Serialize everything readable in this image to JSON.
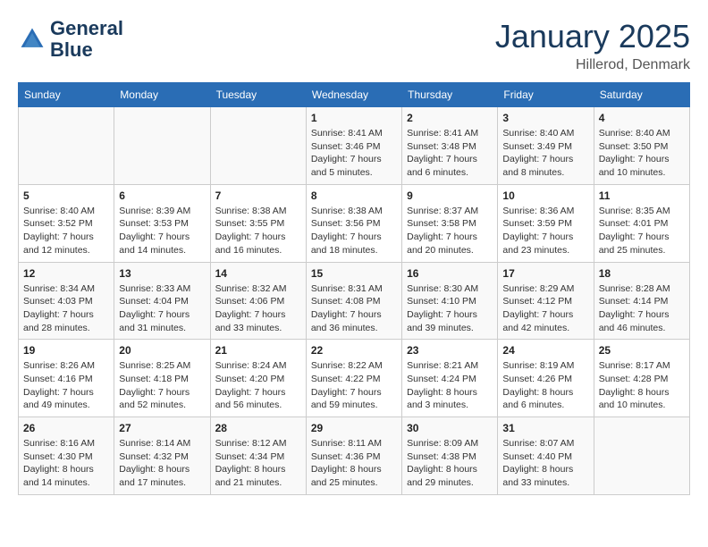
{
  "header": {
    "logo_line1": "General",
    "logo_line2": "Blue",
    "month": "January 2025",
    "location": "Hillerod, Denmark"
  },
  "weekdays": [
    "Sunday",
    "Monday",
    "Tuesday",
    "Wednesday",
    "Thursday",
    "Friday",
    "Saturday"
  ],
  "weeks": [
    [
      {
        "day": "",
        "info": ""
      },
      {
        "day": "",
        "info": ""
      },
      {
        "day": "",
        "info": ""
      },
      {
        "day": "1",
        "info": "Sunrise: 8:41 AM\nSunset: 3:46 PM\nDaylight: 7 hours\nand 5 minutes."
      },
      {
        "day": "2",
        "info": "Sunrise: 8:41 AM\nSunset: 3:48 PM\nDaylight: 7 hours\nand 6 minutes."
      },
      {
        "day": "3",
        "info": "Sunrise: 8:40 AM\nSunset: 3:49 PM\nDaylight: 7 hours\nand 8 minutes."
      },
      {
        "day": "4",
        "info": "Sunrise: 8:40 AM\nSunset: 3:50 PM\nDaylight: 7 hours\nand 10 minutes."
      }
    ],
    [
      {
        "day": "5",
        "info": "Sunrise: 8:40 AM\nSunset: 3:52 PM\nDaylight: 7 hours\nand 12 minutes."
      },
      {
        "day": "6",
        "info": "Sunrise: 8:39 AM\nSunset: 3:53 PM\nDaylight: 7 hours\nand 14 minutes."
      },
      {
        "day": "7",
        "info": "Sunrise: 8:38 AM\nSunset: 3:55 PM\nDaylight: 7 hours\nand 16 minutes."
      },
      {
        "day": "8",
        "info": "Sunrise: 8:38 AM\nSunset: 3:56 PM\nDaylight: 7 hours\nand 18 minutes."
      },
      {
        "day": "9",
        "info": "Sunrise: 8:37 AM\nSunset: 3:58 PM\nDaylight: 7 hours\nand 20 minutes."
      },
      {
        "day": "10",
        "info": "Sunrise: 8:36 AM\nSunset: 3:59 PM\nDaylight: 7 hours\nand 23 minutes."
      },
      {
        "day": "11",
        "info": "Sunrise: 8:35 AM\nSunset: 4:01 PM\nDaylight: 7 hours\nand 25 minutes."
      }
    ],
    [
      {
        "day": "12",
        "info": "Sunrise: 8:34 AM\nSunset: 4:03 PM\nDaylight: 7 hours\nand 28 minutes."
      },
      {
        "day": "13",
        "info": "Sunrise: 8:33 AM\nSunset: 4:04 PM\nDaylight: 7 hours\nand 31 minutes."
      },
      {
        "day": "14",
        "info": "Sunrise: 8:32 AM\nSunset: 4:06 PM\nDaylight: 7 hours\nand 33 minutes."
      },
      {
        "day": "15",
        "info": "Sunrise: 8:31 AM\nSunset: 4:08 PM\nDaylight: 7 hours\nand 36 minutes."
      },
      {
        "day": "16",
        "info": "Sunrise: 8:30 AM\nSunset: 4:10 PM\nDaylight: 7 hours\nand 39 minutes."
      },
      {
        "day": "17",
        "info": "Sunrise: 8:29 AM\nSunset: 4:12 PM\nDaylight: 7 hours\nand 42 minutes."
      },
      {
        "day": "18",
        "info": "Sunrise: 8:28 AM\nSunset: 4:14 PM\nDaylight: 7 hours\nand 46 minutes."
      }
    ],
    [
      {
        "day": "19",
        "info": "Sunrise: 8:26 AM\nSunset: 4:16 PM\nDaylight: 7 hours\nand 49 minutes."
      },
      {
        "day": "20",
        "info": "Sunrise: 8:25 AM\nSunset: 4:18 PM\nDaylight: 7 hours\nand 52 minutes."
      },
      {
        "day": "21",
        "info": "Sunrise: 8:24 AM\nSunset: 4:20 PM\nDaylight: 7 hours\nand 56 minutes."
      },
      {
        "day": "22",
        "info": "Sunrise: 8:22 AM\nSunset: 4:22 PM\nDaylight: 7 hours\nand 59 minutes."
      },
      {
        "day": "23",
        "info": "Sunrise: 8:21 AM\nSunset: 4:24 PM\nDaylight: 8 hours\nand 3 minutes."
      },
      {
        "day": "24",
        "info": "Sunrise: 8:19 AM\nSunset: 4:26 PM\nDaylight: 8 hours\nand 6 minutes."
      },
      {
        "day": "25",
        "info": "Sunrise: 8:17 AM\nSunset: 4:28 PM\nDaylight: 8 hours\nand 10 minutes."
      }
    ],
    [
      {
        "day": "26",
        "info": "Sunrise: 8:16 AM\nSunset: 4:30 PM\nDaylight: 8 hours\nand 14 minutes."
      },
      {
        "day": "27",
        "info": "Sunrise: 8:14 AM\nSunset: 4:32 PM\nDaylight: 8 hours\nand 17 minutes."
      },
      {
        "day": "28",
        "info": "Sunrise: 8:12 AM\nSunset: 4:34 PM\nDaylight: 8 hours\nand 21 minutes."
      },
      {
        "day": "29",
        "info": "Sunrise: 8:11 AM\nSunset: 4:36 PM\nDaylight: 8 hours\nand 25 minutes."
      },
      {
        "day": "30",
        "info": "Sunrise: 8:09 AM\nSunset: 4:38 PM\nDaylight: 8 hours\nand 29 minutes."
      },
      {
        "day": "31",
        "info": "Sunrise: 8:07 AM\nSunset: 4:40 PM\nDaylight: 8 hours\nand 33 minutes."
      },
      {
        "day": "",
        "info": ""
      }
    ]
  ]
}
